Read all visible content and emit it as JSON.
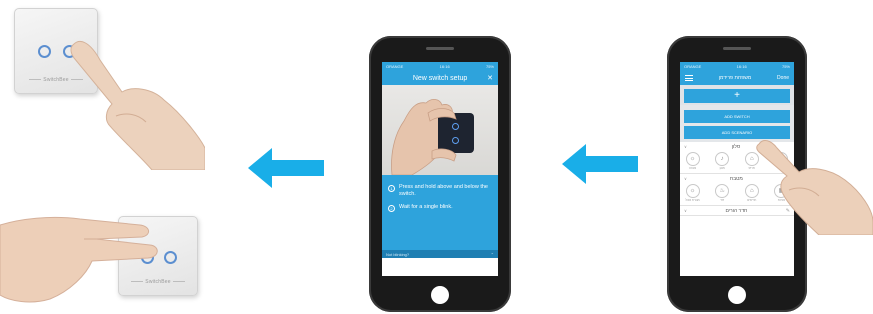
{
  "left_panels": {
    "switch_label": "SwitchBee"
  },
  "phone_setup": {
    "status": {
      "carrier": "ORANGE",
      "time": "16:16",
      "battery": "75%"
    },
    "title": "New switch setup",
    "close_icon": "close-x-icon",
    "steps": [
      {
        "num": "1",
        "text": "Press and hold above and below the switch."
      },
      {
        "num": "2",
        "text": "Wait for a single blink."
      }
    ],
    "bottom_bar": {
      "label": "Not blinking?",
      "chevron": "chevron-up-icon"
    }
  },
  "phone_rooms": {
    "status": {
      "carrier": "ORANGE",
      "time": "16:16",
      "battery": "75%"
    },
    "title": "משפחת פרידמן",
    "done_label": "Done",
    "add_label": "+",
    "menu": [
      "ADD SWITCH",
      "ADD SCENARIO"
    ],
    "rooms": [
      {
        "name": "סלון",
        "devices": [
          {
            "glyph": "☼",
            "label": "מנורה"
          },
          {
            "glyph": "♪",
            "label": "מזגן"
          },
          {
            "glyph": "⌂",
            "label": "תריס"
          },
          {
            "glyph": "✦",
            "label": "אורות"
          }
        ]
      },
      {
        "name": "מטבח",
        "devices": [
          {
            "glyph": "☼",
            "label": "מנורת אוכל"
          },
          {
            "glyph": "♨",
            "label": "דוד"
          },
          {
            "glyph": "⌂",
            "label": "תריסים"
          },
          {
            "glyph": "▦",
            "label": "אורות"
          }
        ]
      },
      {
        "name": "חדר הורים",
        "devices": []
      }
    ]
  },
  "colors": {
    "accent": "#2ea3dc",
    "arrow": "#19aee8",
    "ring": "#5c8fd0",
    "phone_body": "#1a1a1a"
  }
}
